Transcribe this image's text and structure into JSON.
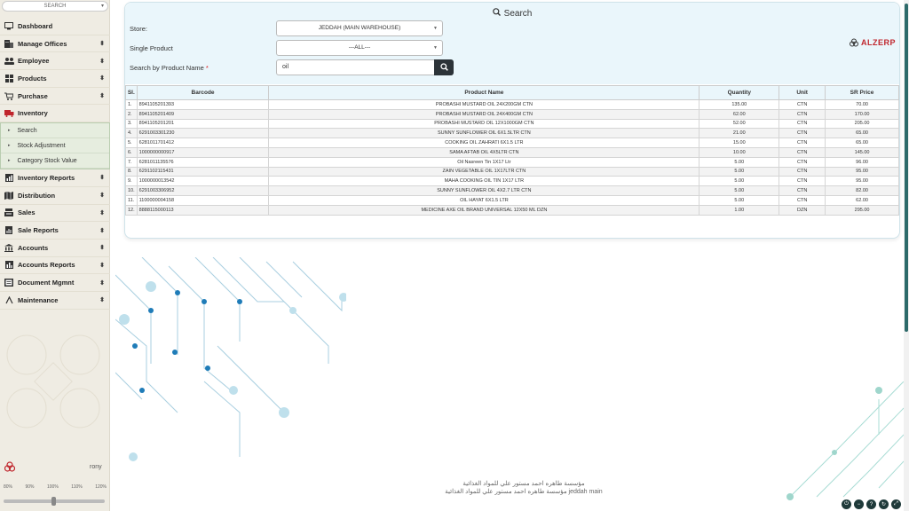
{
  "sidebar": {
    "search_label": "SEARCH",
    "items": [
      {
        "label": "Dashboard",
        "icon": "monitor-icon",
        "arrow": false
      },
      {
        "label": "Manage Offices",
        "icon": "building-icon",
        "arrow": true
      },
      {
        "label": "Employee",
        "icon": "users-icon",
        "arrow": true
      },
      {
        "label": "Products",
        "icon": "grid-icon",
        "arrow": true
      },
      {
        "label": "Purchase",
        "icon": "cart-icon",
        "arrow": true
      },
      {
        "label": "Inventory",
        "icon": "truck-icon",
        "arrow": false
      }
    ],
    "submenu": [
      "Search",
      "Stock Adjustment",
      "Category Stock Value"
    ],
    "items2": [
      {
        "label": "Inventory Reports",
        "icon": "bar-chart-icon"
      },
      {
        "label": "Distribution",
        "icon": "map-icon"
      },
      {
        "label": "Sales",
        "icon": "register-icon"
      },
      {
        "label": "Sale Reports",
        "icon": "file-chart-icon"
      },
      {
        "label": "Accounts",
        "icon": "bank-icon"
      },
      {
        "label": "Accounts Reports",
        "icon": "report-icon"
      },
      {
        "label": "Document Mgmnt",
        "icon": "folder-icon"
      },
      {
        "label": "Maintenance",
        "icon": "wrench-icon"
      }
    ],
    "user": "rony",
    "zoom_levels": [
      "80%",
      "90%",
      "100%",
      "110%",
      "120%"
    ]
  },
  "search_card": {
    "title": "Search",
    "store_label": "Store:",
    "store_value": "JEDDAH (MAIN WAREHOUSE)",
    "single_product_label": "Single Product",
    "single_product_value": "---ALL---",
    "product_name_label": "Search by Product Name",
    "required_mark": "*",
    "product_name_value": "oil",
    "brand": "ALZERP"
  },
  "table": {
    "headers": [
      "Sl.",
      "Barcode",
      "Product Name",
      "Quantity",
      "Unit",
      "SR Price"
    ],
    "rows": [
      [
        "1.",
        "8941105201393",
        "PROBASHI MUSTARD OIL 24X200GM CTN",
        "135.00",
        "CTN",
        "70.00"
      ],
      [
        "2.",
        "8941105201409",
        "PROBASHI MUSTARD OIL 24X400GM CTN",
        "62.00",
        "CTN",
        "170.00"
      ],
      [
        "3.",
        "8941105201201",
        "PROBASHI MUSTARD OIL 12X1000GM CTN",
        "52.00",
        "CTN",
        "205.00"
      ],
      [
        "4.",
        "6291003301230",
        "SUNNY SUNFLOWER OIL 6X1.5LTR CTN",
        "21.00",
        "CTN",
        "65.00"
      ],
      [
        "5.",
        "6281011701412",
        "COOKING OIL ZAHRATI 6X1.5 LTR",
        "15.00",
        "CTN",
        "65.00"
      ],
      [
        "6.",
        "1000000000917",
        "SAMA AFTAB OIL 4X5LTR CTN",
        "10.00",
        "CTN",
        "145.00"
      ],
      [
        "7.",
        "6281011135576",
        "Oil Nasreen Tin 1X17 Ltr",
        "5.00",
        "CTN",
        "96.00"
      ],
      [
        "8.",
        "6291102115431",
        "ZAIN VEGETABLE OIL 1X17LTR CTN",
        "5.00",
        "CTN",
        "95.00"
      ],
      [
        "9.",
        "1000000013542",
        "MAHA COOKING OIL TIN 1X17 LTR",
        "5.00",
        "CTN",
        "95.00"
      ],
      [
        "10.",
        "6291003306952",
        "SUNNY SUNFLOWER OIL 4X2.7 LTR CTN",
        "5.00",
        "CTN",
        "82.00"
      ],
      [
        "11.",
        "1100000004158",
        "OIL HAYAT 6X1.5 LTR",
        "5.00",
        "CTN",
        "62.00"
      ],
      [
        "12.",
        "8888115000113",
        "MEDICINE AXE OIL BRAND UNIVERSAL 12X50 ML DZN",
        "1.00",
        "DZN",
        "295.00"
      ]
    ]
  },
  "footer": {
    "line1": "مؤسسة طاهره احمد مستور علي للمواد الغذائية",
    "line2": "مؤسسة طاهره احمد مستور علي للمواد الغذائية jeddah main"
  },
  "colors": {
    "accent": "#2d6a6a",
    "brand_red": "#c0262d",
    "header_bg": "#eaf6fb"
  }
}
